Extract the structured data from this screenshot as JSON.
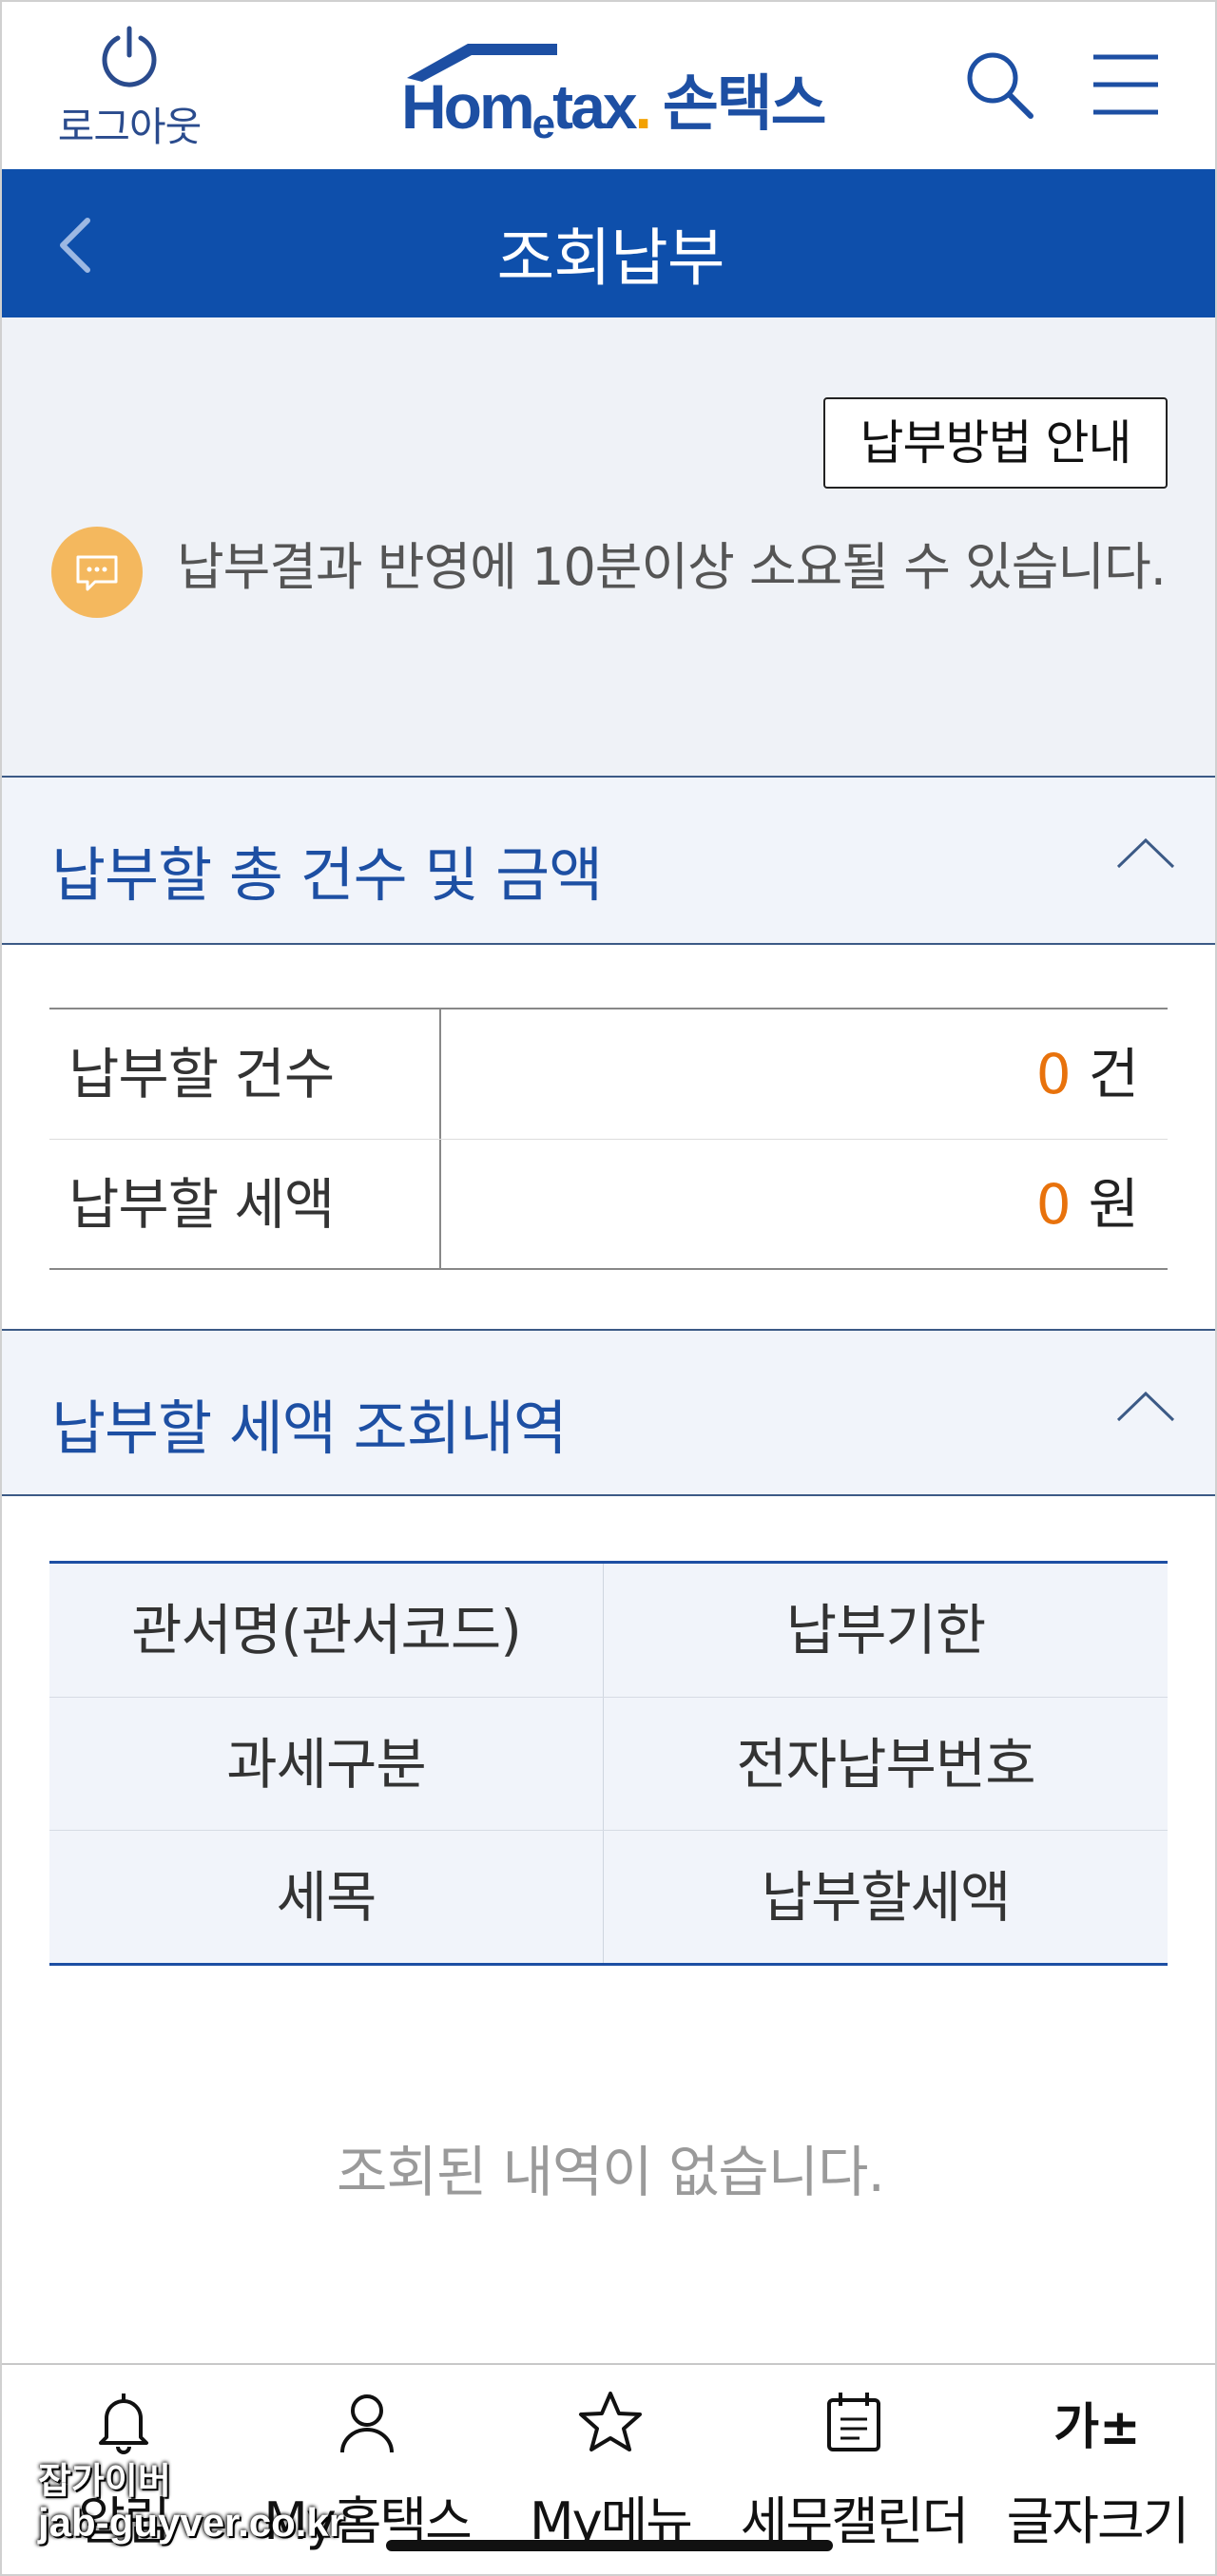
{
  "header": {
    "logout_label": "로그아웃",
    "logo_text_home": "Hom",
    "logo_text_e": "e",
    "logo_text_tax": "tax",
    "logo_text_dot": ".",
    "logo_kr": "손택스",
    "icons": [
      "power-icon",
      "search-icon",
      "menu-icon"
    ]
  },
  "titlebar": {
    "title": "조회납부",
    "back_icon": "chevron-left-icon"
  },
  "notice": {
    "guide_button": "납부방법 안내",
    "message": "납부결과 반영에 10분이상 소요될 수 있습니다."
  },
  "summary_section": {
    "title": "납부할 총 건수 및 금액",
    "rows": [
      {
        "label": "납부할 건수",
        "value": "0",
        "unit": "건"
      },
      {
        "label": "납부할 세액",
        "value": "0",
        "unit": "원"
      }
    ]
  },
  "detail_section": {
    "title": "납부할 세액 조회내역",
    "columns": [
      [
        "관서명(관서코드)",
        "납부기한"
      ],
      [
        "과세구분",
        "전자납부번호"
      ],
      [
        "세목",
        "납부할세액"
      ]
    ],
    "empty_message": "조회된 내역이 없습니다."
  },
  "tabbar": {
    "items": [
      {
        "label": "알림",
        "icon": "bell-icon"
      },
      {
        "label": "My홈택스",
        "icon": "user-icon"
      },
      {
        "label": "My메뉴",
        "icon": "star-icon"
      },
      {
        "label": "세무캘린더",
        "icon": "calendar-icon"
      },
      {
        "label": "글자크기",
        "icon": "font-size-icon",
        "icon_text": "가±"
      }
    ]
  },
  "watermark": {
    "line1": "잡가이버",
    "line2": "jab-guyver.co.kr"
  },
  "colors": {
    "brand_blue": "#0e4fab",
    "accent_orange": "#e8720c",
    "chat_yellow": "#f4b85e"
  }
}
